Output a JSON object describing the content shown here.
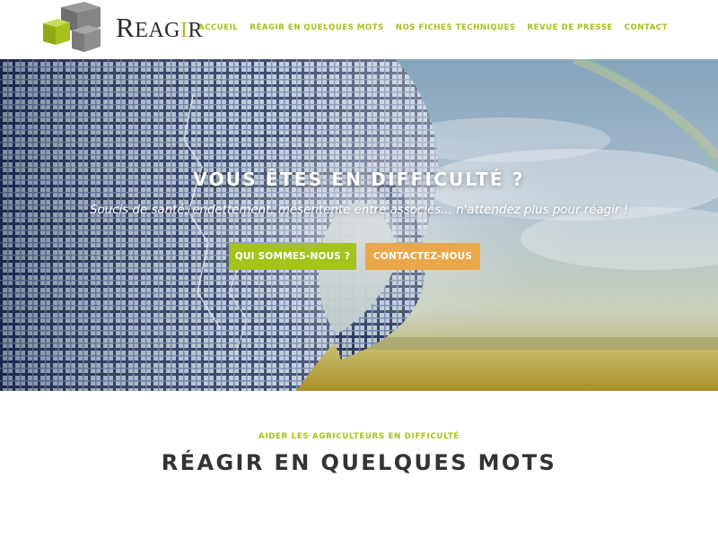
{
  "brand": {
    "name_first": "R",
    "name_middle": "EAG",
    "name_accent": "I",
    "name_last": "R"
  },
  "nav": {
    "items": [
      {
        "label": "ACCUEIL"
      },
      {
        "label": "RÉAGIR EN QUELQUES MOTS"
      },
      {
        "label": "NOS FICHES TECHNIQUES"
      },
      {
        "label": "REVUE DE PRESSE"
      },
      {
        "label": "CONTACT"
      }
    ]
  },
  "hero": {
    "title": "VOUS ÊTES EN DIFFICULTÉ ?",
    "subtitle": "Soucis de santé, endettement, mésentente entre associés... n'attendez plus pour réagir !",
    "buttons": {
      "about": "QUI SOMMES-NOUS ?",
      "contact": "CONTACTEZ-NOUS"
    }
  },
  "intro": {
    "kicker": "AIDER LES AGRICULTEURS EN DIFFICULTÉ",
    "title": "RÉAGIR EN QUELQUES MOTS"
  },
  "colors": {
    "accent_green": "#a4c31c",
    "accent_orange": "#eaa84a",
    "heading_dark": "#333333"
  },
  "icons": {
    "logo": "stacked-cubes-logo-icon"
  }
}
